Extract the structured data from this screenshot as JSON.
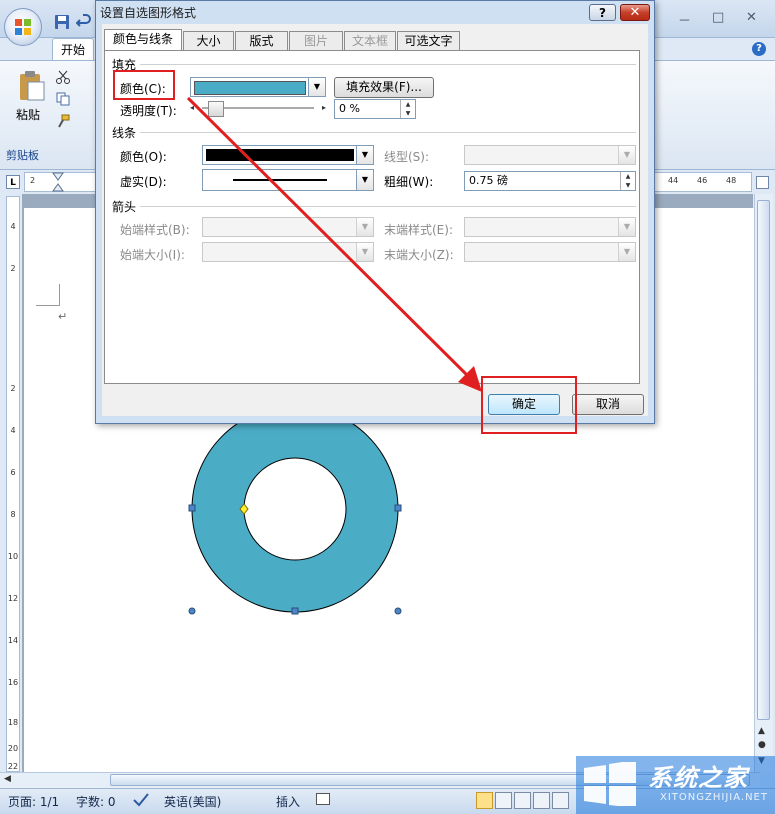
{
  "ribbon": {
    "tab_home": "开始",
    "paste_label": "粘贴",
    "clipboard_group": "剪贴板"
  },
  "ruler": {
    "h_ticks_left": [
      "2"
    ],
    "h_ticks_right": [
      "44",
      "46",
      "48"
    ],
    "v_ticks": [
      "4",
      "2",
      "2",
      "4",
      "6",
      "8",
      "10",
      "12",
      "14",
      "16",
      "18",
      "20",
      "22"
    ]
  },
  "status": {
    "page": "页面: 1/1",
    "words": "字数: 0",
    "language": "英语(美国)",
    "insert": "插入"
  },
  "watermark": {
    "brand": "系统之家",
    "url": "XITONGZHIJIA.NET"
  },
  "dialog": {
    "title": "设置自选图形格式",
    "help": "?",
    "close": "✕",
    "tabs": [
      {
        "label": "颜色与线条"
      },
      {
        "label": "大小"
      },
      {
        "label": "版式"
      },
      {
        "label": "图片"
      },
      {
        "label": "文本框"
      },
      {
        "label": "可选文字"
      }
    ],
    "fill": {
      "section": "填充",
      "color_label": "颜色(C):",
      "color_value": "#4bacc6",
      "effects_button": "填充效果(F)...",
      "transparency_label": "透明度(T):",
      "transparency_value": "0 %"
    },
    "line": {
      "section": "线条",
      "color_label": "颜色(O):",
      "dash_label": "虚实(D):",
      "style_label": "线型(S):",
      "weight_label": "粗细(W):",
      "weight_value": "0.75 磅"
    },
    "arrows": {
      "section": "箭头",
      "begin_style": "始端样式(B):",
      "end_style": "末端样式(E):",
      "begin_size": "始端大小(I):",
      "end_size": "末端大小(Z):"
    },
    "ok_button": "确定",
    "cancel_button": "取消"
  },
  "colors": {
    "accent_fill": "#4bacc6",
    "highlight_red": "#e02020"
  }
}
